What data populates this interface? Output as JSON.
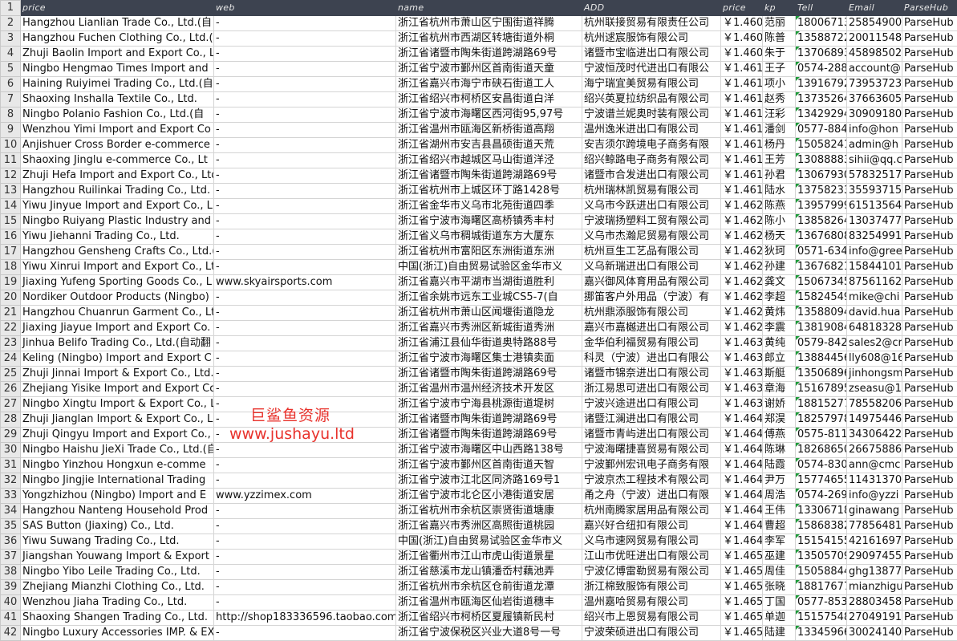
{
  "sheet": {
    "columns": [
      "price",
      "web",
      "name",
      "ADD",
      "price",
      "kp",
      "Tell",
      "Email",
      "ParseHub"
    ],
    "rows": [
      {
        "n": "2",
        "a": "Hangzhou Lianlian Trade Co., Ltd.(自",
        "b": "-",
        "c": "浙江省杭州市萧山区宁围街道祥腾",
        "d": "杭州联接贸易有限责任公司",
        "e": "￥1.460",
        "f": "范丽",
        "g": "18006713",
        "h": "25854900",
        "i": "ParseHub"
      },
      {
        "n": "3",
        "a": "Hangzhou Fuchen Clothing Co., Ltd.(",
        "b": "-",
        "c": "浙江省杭州市西湖区转塘街道外桐",
        "d": "杭州逑宸服饰有限公司",
        "e": "￥1.460",
        "f": "陈普",
        "g": "13588722",
        "h": "20011548",
        "i": "ParseHub"
      },
      {
        "n": "4",
        "a": "Zhuji Baolin Import and Export Co., L",
        "b": "-",
        "c": "浙江省诸暨市陶朱街道跨湖路69号",
        "d": "诸暨市宝临进出口有限公司",
        "e": "￥1.460",
        "f": "朱于",
        "g": "13706893",
        "h": "45898502",
        "i": "ParseHub"
      },
      {
        "n": "5",
        "a": "Ningbo Hengmao Times Import and",
        "b": "-",
        "c": "浙江省宁波市鄞州区首南街道天童",
        "d": "宁波恒茂时代进出口有限公",
        "e": "￥1.461",
        "f": "王子",
        "g": "0574-288",
        "h": "account@",
        "i": "ParseHub"
      },
      {
        "n": "6",
        "a": "Haining Ruiyimei Trading Co., Ltd.(自",
        "b": "-",
        "c": "浙江省嘉兴市海宁市硖石街道工人",
        "d": "海宁瑞宜美贸易有限公司",
        "e": "￥1.461",
        "f": "项小",
        "g": "13916792",
        "h": "73953723",
        "i": "ParseHub"
      },
      {
        "n": "7",
        "a": "Shaoxing Inshalla Textile Co., Ltd.",
        "b": "-",
        "c": "浙江省绍兴市柯桥区安昌街道白洋",
        "d": "绍兴英夏拉纺织品有限公司",
        "e": "￥1.461",
        "f": "赵秀",
        "g": "13735264",
        "h": "37663605",
        "i": "ParseHub"
      },
      {
        "n": "8",
        "a": "Ningbo Polanio Fashion Co., Ltd.(自",
        "b": "-",
        "c": "浙江省宁波市海曙区西河街95,97号",
        "d": "宁波谱兰妮奥时装有限公司",
        "e": "￥1.461",
        "f": "汪彩",
        "g": "13429294",
        "h": "30909180",
        "i": "ParseHub"
      },
      {
        "n": "9",
        "a": "Wenzhou Yimi Import and Export Co",
        "b": "-",
        "c": "浙江省温州市瓯海区新桥街道高翔",
        "d": "温州逸米进出口有限公司",
        "e": "￥1.461",
        "f": "潘剑",
        "g": "0577-884",
        "h": "info@hon",
        "i": "ParseHub"
      },
      {
        "n": "10",
        "a": "Anjishuer Cross Border e-commerce",
        "b": "-",
        "c": "浙江省湖州市安吉县昌硕街道天荒",
        "d": "安吉须尔跨境电子商务有限",
        "e": "￥1.461",
        "f": "杨丹",
        "g": "15058241",
        "h": "admin@h",
        "i": "ParseHub"
      },
      {
        "n": "11",
        "a": "Shaoxing Jinglu e-commerce Co., Lt",
        "b": "-",
        "c": "浙江省绍兴市越城区马山街道洋泾",
        "d": "绍兴鲸路电子商务有限公司",
        "e": "￥1.461",
        "f": "王芳",
        "g": "13088883",
        "h": "sihii@qq.c",
        "i": "ParseHub"
      },
      {
        "n": "12",
        "a": "Zhuji Hefa Import and Export Co., Ltd",
        "b": "-",
        "c": "浙江省诸暨市陶朱街道跨湖路69号",
        "d": "诸暨市合发进出口有限公司",
        "e": "￥1.461",
        "f": "孙君",
        "g": "13067930",
        "h": "57832517",
        "i": "ParseHub"
      },
      {
        "n": "13",
        "a": "Hangzhou Ruilinkai Trading Co., Ltd.",
        "b": "-",
        "c": "浙江省杭州市上城区环丁路1428号",
        "d": "杭州瑞林凯贸易有限公司",
        "e": "￥1.461",
        "f": "陆水",
        "g": "13758233",
        "h": "35593715",
        "i": "ParseHub"
      },
      {
        "n": "14",
        "a": "Yiwu Jinyue Import and Export Co., L",
        "b": "-",
        "c": "浙江省金华市义乌市北苑街道四季",
        "d": "义乌市今跃进出口有限公司",
        "e": "￥1.462",
        "f": "陈燕",
        "g": "13957999",
        "h": "61513564",
        "i": "ParseHub"
      },
      {
        "n": "15",
        "a": "Ningbo Ruiyang Plastic Industry and",
        "b": "-",
        "c": "浙江省宁波市海曙区高桥镇秀丰村",
        "d": "宁波瑞扬塑料工贸有限公司",
        "e": "￥1.462",
        "f": "陈小",
        "g": "13858264",
        "h": "13037477",
        "i": "ParseHub"
      },
      {
        "n": "16",
        "a": "Yiwu Jiehanni Trading Co., Ltd.",
        "b": "-",
        "c": "浙江省义乌市稠城街道东方大厦东",
        "d": "义乌市杰瀚尼贸易有限公司",
        "e": "￥1.462",
        "f": "杨天",
        "g": "13676808",
        "h": "83254991",
        "i": "ParseHub"
      },
      {
        "n": "17",
        "a": "Hangzhou Gensheng Crafts Co., Ltd.(",
        "b": "-",
        "c": "浙江省杭州市富阳区东洲街道东洲",
        "d": "杭州亘生工艺品有限公司",
        "e": "￥1.462",
        "f": "狄珂",
        "g": "0571-634",
        "h": "info@gree",
        "i": "ParseHub"
      },
      {
        "n": "18",
        "a": "Yiwu Xinrui Import and Export Co., Lt",
        "b": "-",
        "c": "中国(浙江)自由贸易试验区金华市义",
        "d": "义乌新瑞进出口有限公司",
        "e": "￥1.462",
        "f": "孙建",
        "g": "13676821",
        "h": "15844101",
        "i": "ParseHub"
      },
      {
        "n": "19",
        "a": "Jiaxing Yufeng Sporting Goods Co., L",
        "b": "www.skyairsports.com",
        "c": "浙江省嘉兴市平湖市当湖街道胜利",
        "d": "嘉兴御风体育用品有限公司",
        "e": "￥1.462",
        "f": "龚文",
        "g": "15067345",
        "h": "87561162",
        "i": "ParseHub"
      },
      {
        "n": "20",
        "a": "Nordiker Outdoor Products (Ningbo)",
        "b": "-",
        "c": "浙江省余姚市远东工业城CS5-7(自",
        "d": "挪笛客户外用品（宁波）有",
        "e": "￥1.462",
        "f": "李超",
        "g": "15824549",
        "h": "mike@chi",
        "i": "ParseHub"
      },
      {
        "n": "21",
        "a": "Hangzhou Chuanrun Garment Co., Lt",
        "b": "-",
        "c": "浙江省杭州市萧山区闻堰街道隐龙",
        "d": "杭州鼎添服饰有限公司",
        "e": "￥1.462",
        "f": "黄炜",
        "g": "13588094",
        "h": "david.hua",
        "i": "ParseHub"
      },
      {
        "n": "22",
        "a": "Jiaxing Jiayue Import and Export Co.",
        "b": "-",
        "c": "浙江省嘉兴市秀洲区新城街道秀洲",
        "d": "嘉兴市嘉樾进出口有限公司",
        "e": "￥1.462",
        "f": "李震",
        "g": "13819084",
        "h": "64818328",
        "i": "ParseHub"
      },
      {
        "n": "23",
        "a": "Jinhua Belifo Trading Co., Ltd.(自动翻",
        "b": "-",
        "c": "浙江省浦江县仙华街道奥特路88号",
        "d": "金华伯利福贸易有限公司",
        "e": "￥1.463",
        "f": "黄纯",
        "g": "0579-842",
        "h": "sales2@cr",
        "i": "ParseHub"
      },
      {
        "n": "24",
        "a": "Keling (Ningbo) Import and Export C",
        "b": "-",
        "c": "浙江省宁波市海曙区集士港镇卖面",
        "d": "科灵（宁波）进出口有限公",
        "e": "￥1.463",
        "f": "郎立",
        "g": "13884456",
        "h": "lly608@16",
        "i": "ParseHub"
      },
      {
        "n": "25",
        "a": "Zhuji Jinnai Import & Export Co., Ltd.",
        "b": "-",
        "c": "浙江省诸暨市陶朱街道跨湖路69号",
        "d": "诸暨市锦奈进出口有限公司",
        "e": "￥1.463",
        "f": "斯艇",
        "g": "13506896",
        "h": "jinhongsm",
        "i": "ParseHub"
      },
      {
        "n": "26",
        "a": "Zhejiang Yisike Import and Export Co",
        "b": "-",
        "c": "浙江省温州市温州经济技术开发区",
        "d": "浙江易思可进出口有限公司",
        "e": "￥1.463",
        "f": "章海",
        "g": "15167895",
        "h": "zseasu@1",
        "i": "ParseHub"
      },
      {
        "n": "27",
        "a": "Ningbo Xingtu Import & Export Co., L",
        "b": "-",
        "c": "浙江省宁波市宁海县桃源街道堤树",
        "d": "宁波兴途进出口有限公司",
        "e": "￥1.463",
        "f": "谢娇",
        "g": "18815277",
        "h": "78558206",
        "i": "ParseHub"
      },
      {
        "n": "28",
        "a": "Zhuji Jianglan Import & Export Co., L",
        "b": "-",
        "c": "浙江省诸暨市陶朱街道跨湖路69号",
        "d": "诸暨江澜进出口有限公司",
        "e": "￥1.464",
        "f": "郑淏",
        "g": "18257978",
        "h": "14975446",
        "i": "ParseHub"
      },
      {
        "n": "29",
        "a": "Zhuji Qingyu Import and Export Co.,",
        "b": "-",
        "c": "浙江省诸暨市陶朱街道跨湖路69号",
        "d": "诸暨市青屿进出口有限公司",
        "e": "￥1.464",
        "f": "傅燕",
        "g": "0575-811",
        "h": "34306422",
        "i": "ParseHub"
      },
      {
        "n": "30",
        "a": "Ningbo Haishu JieXi Trade Co., Ltd.(自",
        "b": "-",
        "c": "浙江省宁波市海曙区中山西路138号",
        "d": "宁波海曙捷喜贸易有限公司",
        "e": "￥1.464",
        "f": "陈琳",
        "g": "18268650",
        "h": "26675886",
        "i": "ParseHub"
      },
      {
        "n": "31",
        "a": "Ningbo Yinzhou Hongxun e-comme",
        "b": "-",
        "c": "浙江省宁波市鄞州区首南街道天智",
        "d": "宁波鄞州宏讯电子商务有限",
        "e": "￥1.464",
        "f": "陆霞",
        "g": "0574-830",
        "h": "ann@cmc",
        "i": "ParseHub"
      },
      {
        "n": "32",
        "a": "Ningbo Jingjie International Trading",
        "b": "-",
        "c": "浙江省宁波市江北区同济路169号1",
        "d": "宁波京杰工程技术有限公司",
        "e": "￥1.464",
        "f": "尹万",
        "g": "15774655",
        "h": "11431370",
        "i": "ParseHub"
      },
      {
        "n": "33",
        "a": "Yongzhizhou (Ningbo) Import and E",
        "b": "www.yzzimex.com",
        "c": "浙江省宁波市北仑区小港街道安居",
        "d": "甬之舟（宁波）进出口有限",
        "e": "￥1.464",
        "f": "周浩",
        "g": "0574-269",
        "h": "info@yzzi",
        "i": "ParseHub"
      },
      {
        "n": "34",
        "a": "Hangzhou Nanteng Household Prod",
        "b": "-",
        "c": "浙江省杭州市余杭区崇贤街道塘康",
        "d": "杭州南腾家居用品有限公司",
        "e": "￥1.464",
        "f": "王伟",
        "g": "13306718",
        "h": "ginawang",
        "i": "ParseHub"
      },
      {
        "n": "35",
        "a": "SAS Button (Jiaxing) Co., Ltd.",
        "b": "-",
        "c": "浙江省嘉兴市秀洲区高照街道桃园",
        "d": "嘉兴好合纽扣有限公司",
        "e": "￥1.464",
        "f": "曹超",
        "g": "15868382",
        "h": "77856481",
        "i": "ParseHub"
      },
      {
        "n": "36",
        "a": "Yiwu Suwang Trading Co., Ltd.",
        "b": "-",
        "c": "中国(浙江)自由贸易试验区金华市义",
        "d": "义乌市速网贸易有限公司",
        "e": "￥1.464",
        "f": "李军",
        "g": "15154155",
        "h": "42161697",
        "i": "ParseHub"
      },
      {
        "n": "37",
        "a": "Jiangshan Youwang Import & Export",
        "b": "-",
        "c": "浙江省衢州市江山市虎山街道景星",
        "d": "江山市优旺进出口有限公司",
        "e": "￥1.465",
        "f": "巫建",
        "g": "13505709",
        "h": "29097455",
        "i": "ParseHub"
      },
      {
        "n": "38",
        "a": "Ningbo Yibo Leile Trading Co., Ltd.",
        "b": "-",
        "c": "浙江省慈溪市龙山镇潘岙村藕池弄",
        "d": "宁波亿博雷勒贸易有限公司",
        "e": "￥1.465",
        "f": "周佳",
        "g": "15058844",
        "h": "ghg13877",
        "i": "ParseHub"
      },
      {
        "n": "39",
        "a": "Zhejiang Mianzhi Clothing Co., Ltd.",
        "b": "-",
        "c": "浙江省杭州市余杭区仓前街道龙潭",
        "d": "浙江棉致服饰有限公司",
        "e": "￥1.465",
        "f": "张晓",
        "g": "18817677",
        "h": "mianzhigu",
        "i": "ParseHub"
      },
      {
        "n": "40",
        "a": "Wenzhou Jiaha Trading Co., Ltd.",
        "b": "-",
        "c": "浙江省温州市瓯海区仙岩街道穗丰",
        "d": "温州嘉哈贸易有限公司",
        "e": "￥1.465",
        "f": "丁国",
        "g": "0577-853",
        "h": "28803458",
        "i": "ParseHub"
      },
      {
        "n": "41",
        "a": "Shaoxing Shangen Trading Co., Ltd.",
        "b": "http://shop183336596.taobao.com",
        "c": "浙江省绍兴市柯桥区夏履镇新民村",
        "d": "绍兴市上恩贸易有限公司",
        "e": "￥1.465",
        "f": "单迦",
        "g": "15157548",
        "h": "27049191",
        "i": "ParseHub"
      },
      {
        "n": "42",
        "a": "Ningbo Luxury Accessories IMP. & EX",
        "b": "-",
        "c": "浙江省宁波保税区兴业大道8号一号",
        "d": "宁波荣硕进出口有限公司",
        "e": "￥1.465",
        "f": "陆建",
        "g": "13345966",
        "h": "30024140",
        "i": "ParseHub"
      }
    ]
  },
  "watermark": {
    "line1": "巨鲨鱼资源",
    "line2": "www.jushayu.ltd",
    "color": "#e8322c"
  },
  "colors": {
    "header_bg": "#3d4350",
    "row_number_bg": "#e8e8e8",
    "comment_marker": "#1e9a3a"
  }
}
